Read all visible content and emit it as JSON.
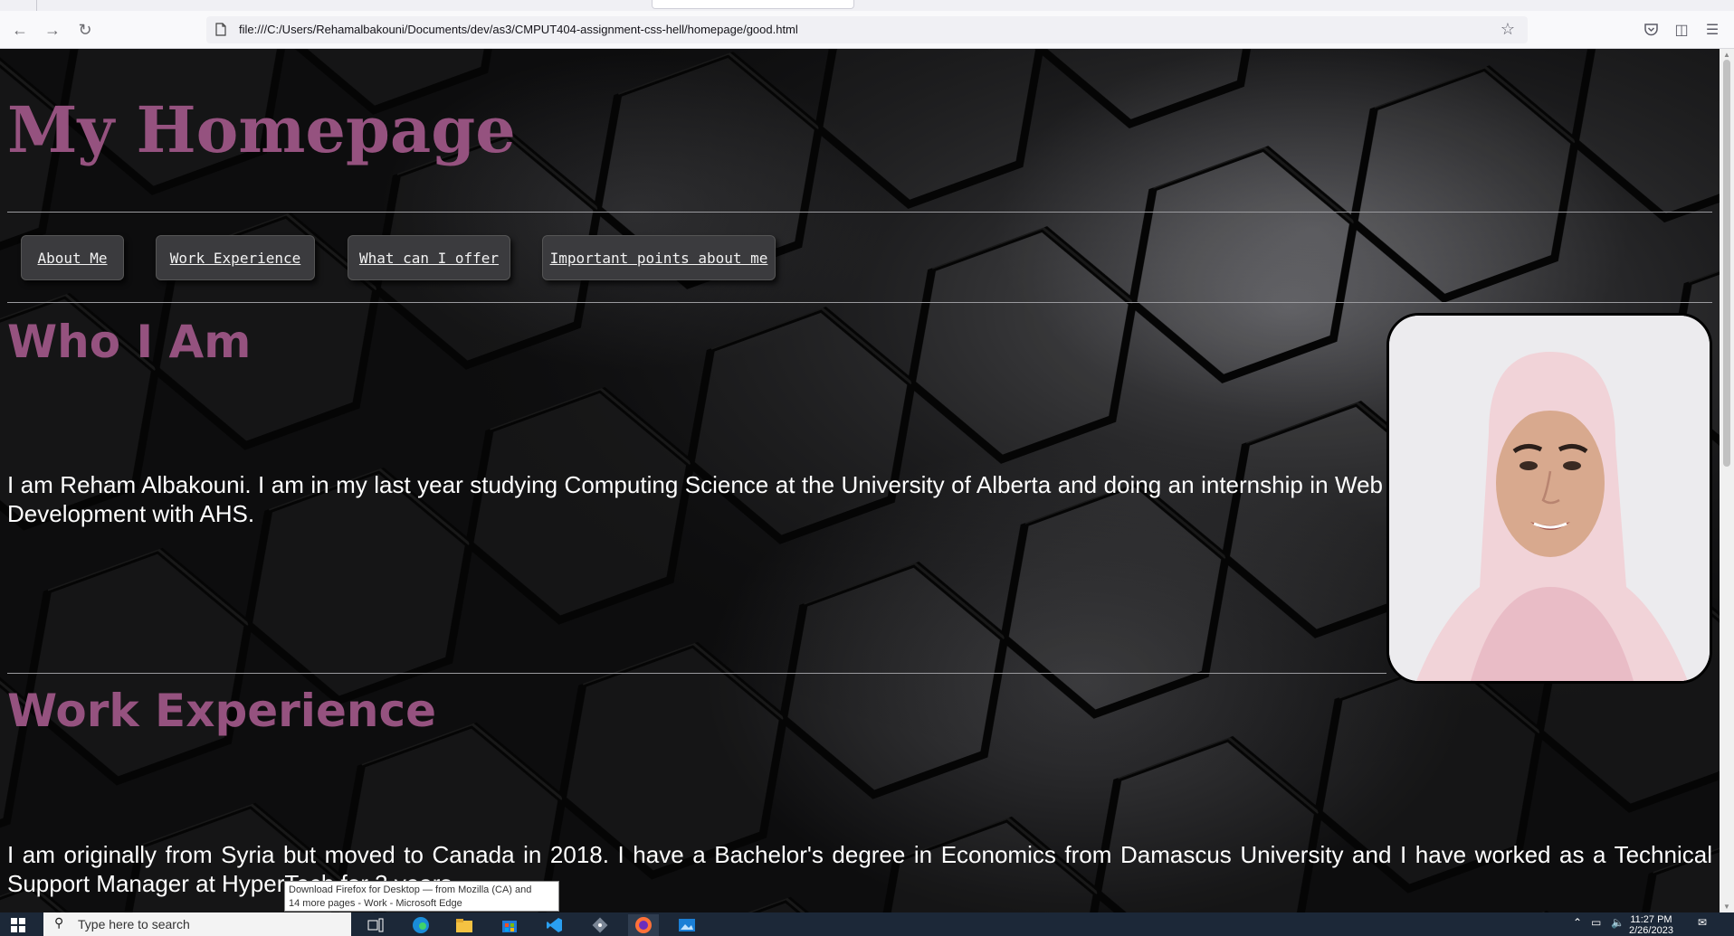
{
  "browser": {
    "url": "file:///C:/Users/Rehamalbakouni/Documents/dev/as3/CMPUT404-assignment-css-hell/homepage/good.html",
    "icons": {
      "back": "arrow-left-icon",
      "forward": "arrow-right-icon",
      "reload": "reload-icon",
      "page": "page-icon",
      "bookmark": "star-icon",
      "pocket": "pocket-icon",
      "extensions": "puzzle-icon",
      "menu": "hamburger-icon"
    }
  },
  "page": {
    "title": "My Homepage",
    "accent_color": "#95527f",
    "nav": [
      {
        "label": "About Me"
      },
      {
        "label": "Work Experience"
      },
      {
        "label": "What can I offer"
      },
      {
        "label": "Important points about me"
      }
    ],
    "sections": [
      {
        "heading": "Who I Am",
        "text": "I am Reham Albakouni. I am in my last year studying Computing Science at the University of Alberta and doing an internship in Web Development with AHS."
      },
      {
        "heading": "Work Experience",
        "text": "I am originally from Syria but moved to Canada in 2018. I have a Bachelor's degree in Economics from Damascus University and I have worked as a Technical Support Manager at HyperTech for 3 years."
      }
    ],
    "photo": {
      "icon": "profile-photo"
    }
  },
  "tooltip": {
    "line1": "Download Firefox for Desktop — from Mozilla (CA) and",
    "line2": "14 more pages - Work - Microsoft Edge"
  },
  "taskbar": {
    "search_placeholder": "Type here to search",
    "time": "11:27 PM",
    "date": "2/26/2023",
    "apps": [
      "task-view-icon",
      "edge-icon",
      "file-explorer-icon",
      "store-icon",
      "vscode-icon",
      "git-icon",
      "firefox-icon",
      "photos-icon"
    ]
  }
}
